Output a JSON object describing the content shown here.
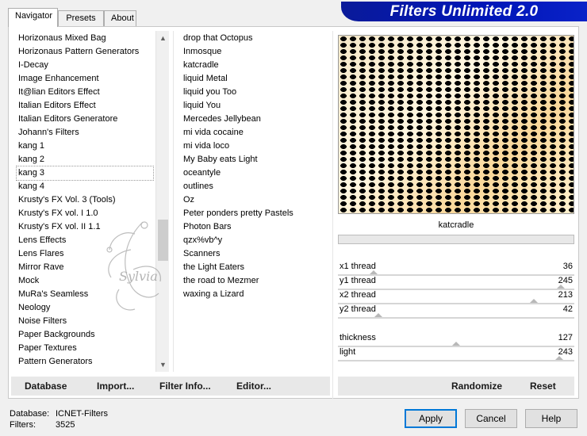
{
  "title": "Filters Unlimited 2.0",
  "tabs": [
    "Navigator",
    "Presets",
    "About"
  ],
  "categories": [
    "Horizonaus Mixed Bag",
    "Horizonaus Pattern Generators",
    "I-Decay",
    "Image Enhancement",
    "It@lian Editors Effect",
    "Italian Editors Effect",
    "Italian Editors Generatore",
    "Johann's Filters",
    "kang 1",
    "kang 2",
    "kang 3",
    "kang 4",
    "Krusty's FX Vol. 3 (Tools)",
    "Krusty's FX vol. I 1.0",
    "Krusty's FX vol. II 1.1",
    "Lens Effects",
    "Lens Flares",
    "Mirror Rave",
    "Mock",
    "MuRa's Seamless",
    "Neology",
    "Noise Filters",
    "Paper Backgrounds",
    "Paper Textures",
    "Pattern Generators"
  ],
  "filters": [
    "drop that Octopus",
    "Inmosque",
    "katcradle",
    "liquid Metal",
    "liquid you Too",
    "liquid You",
    "Mercedes Jellybean",
    "mi vida cocaine",
    "mi vida loco",
    "My Baby eats Light",
    "oceantyle",
    "outlines",
    "Oz",
    "Peter ponders pretty Pastels",
    "Photon Bars",
    "qzx%vb^y",
    "Scanners",
    "the Light Eaters",
    "the road to Mezmer",
    "waxing a Lizard"
  ],
  "selected_filter": "katcradle",
  "params": [
    {
      "label": "x1 thread",
      "value": "36",
      "fraction": 0.14
    },
    {
      "label": "y1 thread",
      "value": "245",
      "fraction": 0.96
    },
    {
      "label": "x2 thread",
      "value": "213",
      "fraction": 0.84
    },
    {
      "label": "y2 thread",
      "value": "42",
      "fraction": 0.16
    },
    {
      "label": "thickness",
      "value": "127",
      "fraction": 0.5
    },
    {
      "label": "light",
      "value": "243",
      "fraction": 0.95
    }
  ],
  "buttons": {
    "database": "Database",
    "import": "Import...",
    "filter_info": "Filter Info...",
    "editor": "Editor...",
    "randomize": "Randomize",
    "reset": "Reset",
    "apply": "Apply",
    "cancel": "Cancel",
    "help": "Help"
  },
  "status": {
    "database_label": "Database:",
    "database_value": "ICNET-Filters",
    "filters_label": "Filters:",
    "filters_value": "3525"
  },
  "watermark_text": "Sylvia"
}
